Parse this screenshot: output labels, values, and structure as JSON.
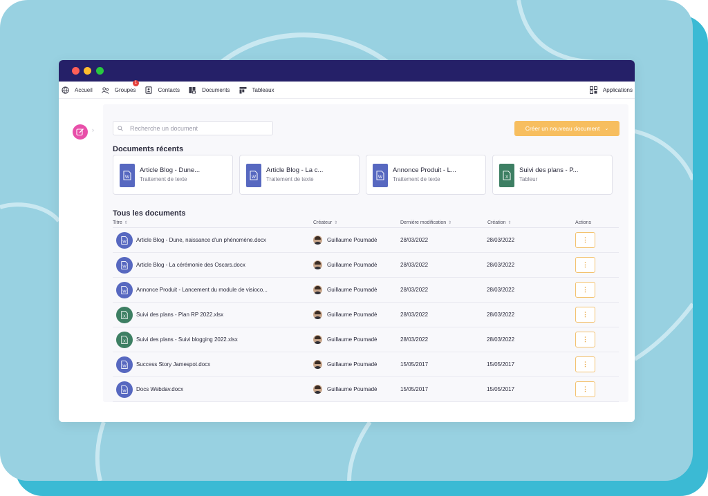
{
  "colors": {
    "word_blue": "#5768c0",
    "excel_green": "#3d7f63",
    "accent_orange": "#f7be5f",
    "titlebar": "#252068",
    "badge_red": "#e5413d"
  },
  "window_dots": [
    "#ff5f57",
    "#febc2e",
    "#28c840"
  ],
  "nav": {
    "items": [
      {
        "label": "Accueil",
        "icon": "globe-icon"
      },
      {
        "label": "Groupes",
        "icon": "users-icon",
        "badge": "1"
      },
      {
        "label": "Contacts",
        "icon": "contact-book-icon"
      },
      {
        "label": "Documents",
        "icon": "documents-icon"
      },
      {
        "label": "Tableaux",
        "icon": "board-icon"
      }
    ],
    "apps_label": "Applications",
    "apps_icon": "grid-icon"
  },
  "side": {
    "button_icon": "edit-icon",
    "chevron": "›"
  },
  "search": {
    "placeholder": "Recherche un document",
    "icon": "search-icon"
  },
  "create_button": {
    "label": "Créer un nouveau document",
    "chevron": "⌄"
  },
  "recent": {
    "title": "Documents récents",
    "cards": [
      {
        "title": "Article Blog - Dune...",
        "subtitle": "Traitement de texte",
        "type": "word",
        "letter": "W"
      },
      {
        "title": "Article Blog - La c...",
        "subtitle": "Traitement de texte",
        "type": "word",
        "letter": "W"
      },
      {
        "title": "Annonce Produit - L...",
        "subtitle": "Traitement de texte",
        "type": "word",
        "letter": "W"
      },
      {
        "title": "Suivi des plans - P...",
        "subtitle": "Tableur",
        "type": "excel",
        "letter": "X"
      }
    ]
  },
  "all": {
    "title": "Tous les documents",
    "columns": {
      "title": "Titre",
      "creator": "Créateur",
      "modified": "Dernière modification",
      "created": "Création",
      "actions": "Actions",
      "sort_glyph": "⇕"
    },
    "rows": [
      {
        "title": "Article Blog - Dune, naissance d'un phénomène.docx",
        "creator": "Guillaume Poumadè",
        "modified": "28/03/2022",
        "created": "28/03/2022",
        "type": "word",
        "letter": "W",
        "action": "⋮"
      },
      {
        "title": "Article Blog - La cérémonie des Oscars.docx",
        "creator": "Guillaume Poumadè",
        "modified": "28/03/2022",
        "created": "28/03/2022",
        "type": "word",
        "letter": "W",
        "action": "⋮"
      },
      {
        "title": "Annonce Produit - Lancement du module de visioco...",
        "creator": "Guillaume Poumadè",
        "modified": "28/03/2022",
        "created": "28/03/2022",
        "type": "word",
        "letter": "W",
        "action": "⋮"
      },
      {
        "title": "Suivi des plans - Plan RP 2022.xlsx",
        "creator": "Guillaume Poumadè",
        "modified": "28/03/2022",
        "created": "28/03/2022",
        "type": "excel",
        "letter": "X",
        "action": "⋮"
      },
      {
        "title": "Suivi des plans - Suivi blogging 2022.xlsx",
        "creator": "Guillaume Poumadè",
        "modified": "28/03/2022",
        "created": "28/03/2022",
        "type": "excel",
        "letter": "X",
        "action": "⋮"
      },
      {
        "title": "Success Story Jamespot.docx",
        "creator": "Guillaume Poumadè",
        "modified": "15/05/2017",
        "created": "15/05/2017",
        "type": "word",
        "letter": "W",
        "action": "⋮"
      },
      {
        "title": "Docs Webdav.docx",
        "creator": "Guillaume Poumadè",
        "modified": "15/05/2017",
        "created": "15/05/2017",
        "type": "word",
        "letter": "W",
        "action": "⋮"
      }
    ]
  }
}
